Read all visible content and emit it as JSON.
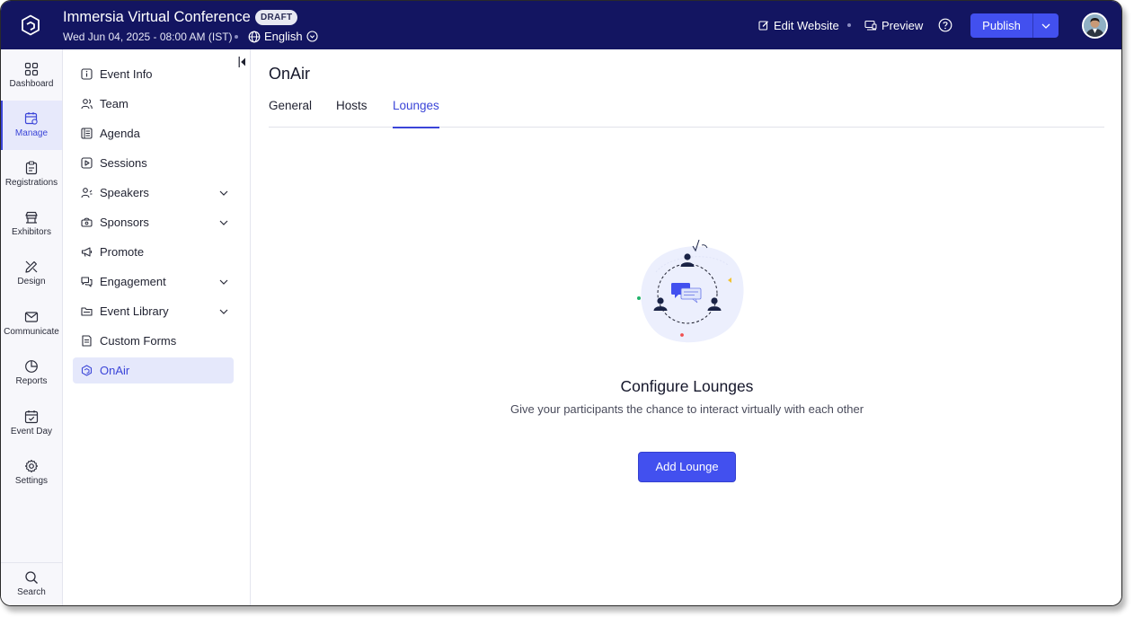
{
  "header": {
    "event_title": "Immersia Virtual Conference",
    "status_badge": "DRAFT",
    "event_datetime": "Wed Jun 04, 2025 - 08:00 AM (IST)",
    "language": "English",
    "edit_website_label": "Edit Website",
    "preview_label": "Preview",
    "publish_label": "Publish",
    "icons": [
      "app-logo-icon",
      "globe-icon",
      "chevron-down-icon",
      "edit-icon",
      "preview-icon",
      "help-icon",
      "avatar"
    ]
  },
  "rail": {
    "items": [
      {
        "label": "Dashboard",
        "icon": "dashboard-icon",
        "active": false
      },
      {
        "label": "Manage",
        "icon": "manage-calendar-icon",
        "active": true
      },
      {
        "label": "Registrations",
        "icon": "clipboard-icon",
        "active": false
      },
      {
        "label": "Exhibitors",
        "icon": "booth-icon",
        "active": false
      },
      {
        "label": "Design",
        "icon": "design-icon",
        "active": false
      },
      {
        "label": "Communicate",
        "icon": "mail-icon",
        "active": false
      },
      {
        "label": "Reports",
        "icon": "pie-chart-icon",
        "active": false
      },
      {
        "label": "Event Day",
        "icon": "calendar-check-icon",
        "active": false
      },
      {
        "label": "Settings",
        "icon": "gear-icon",
        "active": false
      }
    ],
    "search_label": "Search"
  },
  "subnav": {
    "items": [
      {
        "label": "Event Info",
        "icon": "info-icon",
        "expandable": false
      },
      {
        "label": "Team",
        "icon": "team-icon",
        "expandable": false
      },
      {
        "label": "Agenda",
        "icon": "agenda-icon",
        "expandable": false
      },
      {
        "label": "Sessions",
        "icon": "play-icon",
        "expandable": false
      },
      {
        "label": "Speakers",
        "icon": "speaker-icon",
        "expandable": true
      },
      {
        "label": "Sponsors",
        "icon": "sponsor-icon",
        "expandable": true
      },
      {
        "label": "Promote",
        "icon": "megaphone-icon",
        "expandable": false
      },
      {
        "label": "Engagement",
        "icon": "chat-icon",
        "expandable": true
      },
      {
        "label": "Event Library",
        "icon": "folder-icon",
        "expandable": true
      },
      {
        "label": "Custom Forms",
        "icon": "form-icon",
        "expandable": false
      },
      {
        "label": "OnAir",
        "icon": "onair-icon",
        "expandable": false,
        "active": true
      }
    ]
  },
  "main": {
    "page_title": "OnAir",
    "tabs": [
      {
        "label": "General",
        "active": false
      },
      {
        "label": "Hosts",
        "active": false
      },
      {
        "label": "Lounges",
        "active": true
      }
    ],
    "empty_state": {
      "title": "Configure Lounges",
      "description": "Give your participants the chance to interact virtually with each other",
      "button_label": "Add Lounge"
    }
  },
  "colors": {
    "header_bg": "#131561",
    "accent": "#4250ef",
    "active_text": "#3b45d8",
    "active_bg": "#e5e8fb"
  }
}
